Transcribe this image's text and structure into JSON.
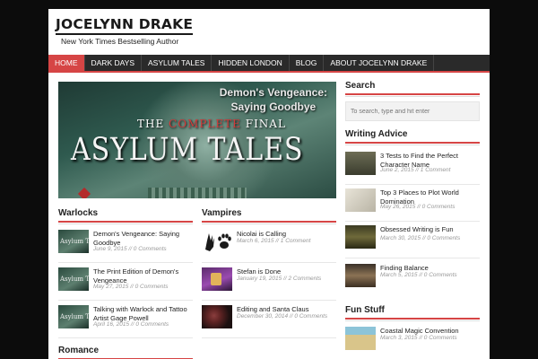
{
  "site": {
    "title": "JOCELYNN DRAKE",
    "tagline": "New York Times Bestselling Author"
  },
  "nav": {
    "items": [
      "HOME",
      "DARK DAYS",
      "ASYLUM TALES",
      "HIDDEN LONDON",
      "BLOG",
      "ABOUT JOCELYNN DRAKE"
    ],
    "active_index": 0
  },
  "hero": {
    "subtitle_line1": "Demon's Vengeance:",
    "subtitle_line2": "Saying Goodbye",
    "complete_prefix": "THE ",
    "complete_red": "COMPLETE",
    "complete_suffix": " FINAL",
    "title": "ASYLUM TALES"
  },
  "warlocks": {
    "heading": "Warlocks",
    "thumb_text": "Asylum Tales",
    "posts": [
      {
        "title": "Demon's Vengeance: Saying Goodbye",
        "meta": "June 9, 2015 // 0 Comments"
      },
      {
        "title": "The Print Edition of Demon's Vengeance",
        "meta": "May 27, 2015 // 0 Comments"
      },
      {
        "title": "Talking with Warlock and Tattoo Artist Gage Powell",
        "meta": "April 16, 2015 // 0 Comments"
      }
    ]
  },
  "vampires": {
    "heading": "Vampires",
    "posts": [
      {
        "title": "Nicolai is Calling",
        "meta": "March 6, 2015 // 1 Comment"
      },
      {
        "title": "Stefan is Done",
        "meta": "January 19, 2015 // 2 Comments"
      },
      {
        "title": "Editing and Santa Claus",
        "meta": "December 30, 2014 // 0 Comments"
      }
    ]
  },
  "romance": {
    "heading": "Romance"
  },
  "sidebar": {
    "search": {
      "heading": "Search",
      "placeholder": "To search, type and hit enter"
    },
    "writing": {
      "heading": "Writing Advice",
      "posts": [
        {
          "title": "3 Tests to Find the Perfect Character Name",
          "meta": "June 2, 2015 // 1 Comment"
        },
        {
          "title": "Top 3 Places to Plot World Domination",
          "meta": "May 26, 2015 // 0 Comments"
        },
        {
          "title": "Obsessed Writing is Fun",
          "meta": "March 30, 2015 // 0 Comments"
        },
        {
          "title": "Finding Balance",
          "meta": "March 5, 2015 // 0 Comments"
        }
      ]
    },
    "fun": {
      "heading": "Fun Stuff",
      "posts": [
        {
          "title": "Coastal Magic Convention",
          "meta": "March 3, 2015 // 0 Comments"
        }
      ]
    }
  },
  "colors": {
    "accent": "#d64545",
    "nav_bg": "#2a2a2a",
    "page_bg": "#0c0c0c"
  }
}
